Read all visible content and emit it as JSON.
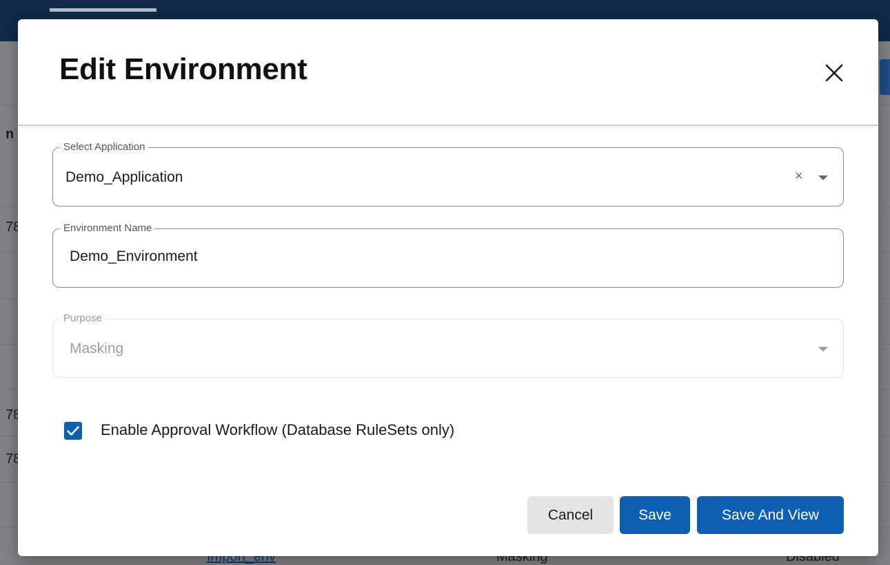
{
  "background": {
    "partial_text": [
      "n",
      "78",
      "78",
      "78"
    ],
    "footer_link": "Import_env",
    "footer_purpose": "Masking",
    "footer_status": "Disabled"
  },
  "dialog": {
    "title": "Edit Environment",
    "close_icon": "close-icon",
    "fields": {
      "application": {
        "label": "Select Application",
        "value": "Demo_Application",
        "clear_symbol": "×"
      },
      "environment_name": {
        "label": "Environment Name",
        "value": "Demo_Environment"
      },
      "purpose": {
        "label": "Purpose",
        "value": "Masking",
        "disabled": true
      }
    },
    "approval_workflow": {
      "label": "Enable Approval Workflow (Database RuleSets only)",
      "checked": true
    },
    "buttons": {
      "cancel": "Cancel",
      "save": "Save",
      "save_and_view": "Save And View"
    }
  },
  "colors": {
    "primary": "#0d5fb3",
    "topbar": "#0f2a4a",
    "overlay": "#818386"
  }
}
